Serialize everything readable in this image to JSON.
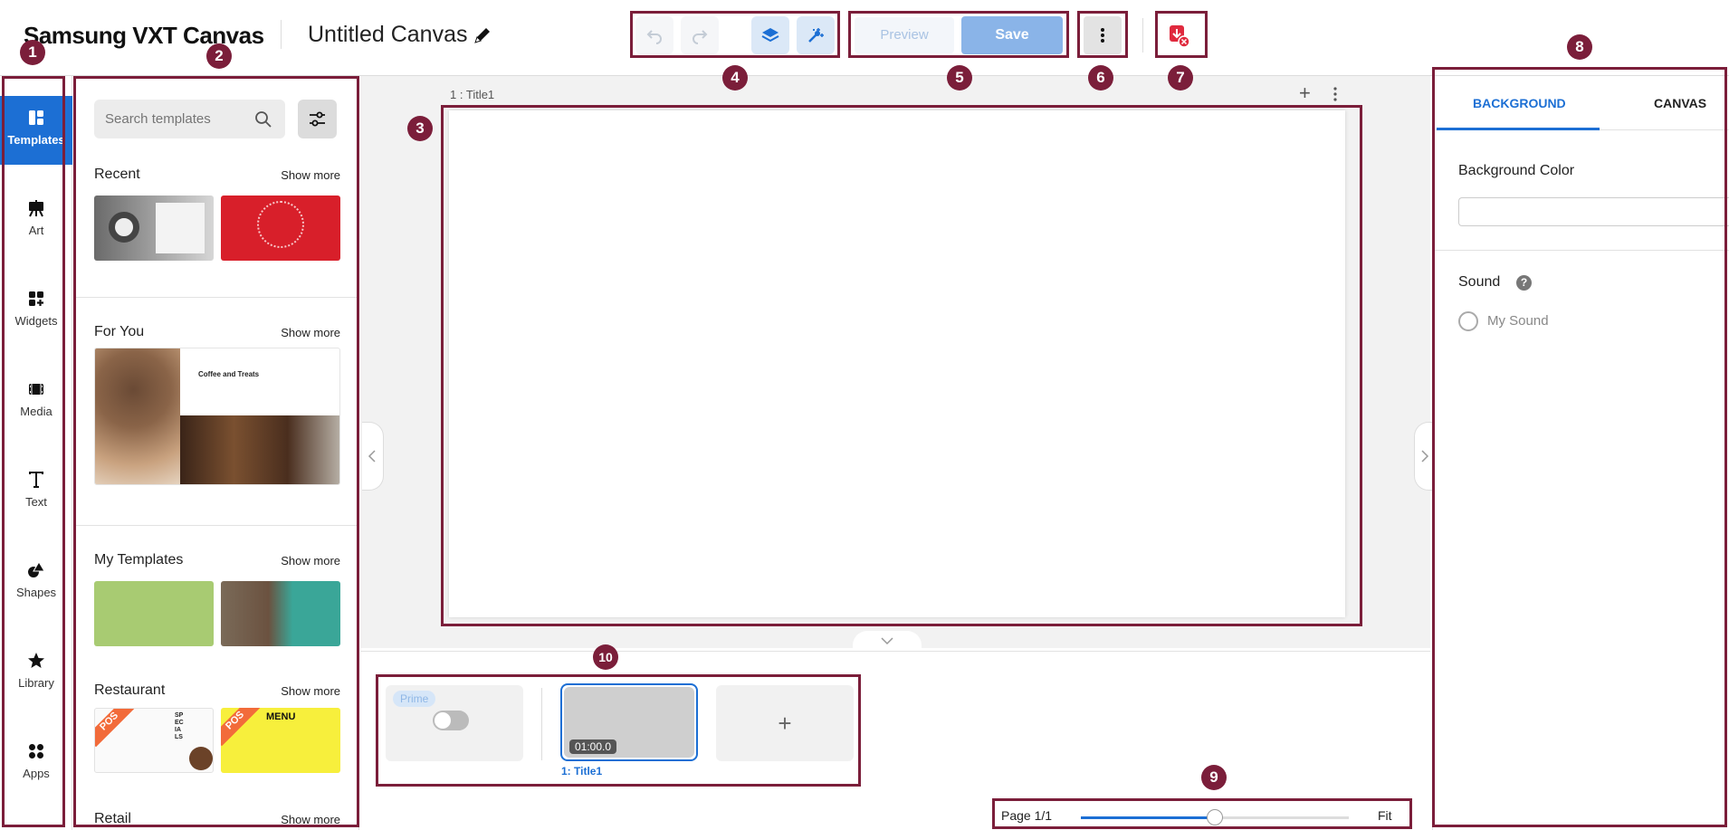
{
  "header": {
    "brand": "Samsung VXT Canvas",
    "canvas_title": "Untitled Canvas",
    "preview_label": "Preview",
    "save_label": "Save"
  },
  "annotations": [
    "1",
    "2",
    "3",
    "4",
    "5",
    "6",
    "7",
    "8",
    "9",
    "10"
  ],
  "rail": {
    "items": [
      {
        "label": "Templates",
        "icon": "templates-icon",
        "active": true
      },
      {
        "label": "Art",
        "icon": "art-easel-icon"
      },
      {
        "label": "Widgets",
        "icon": "widgets-icon"
      },
      {
        "label": "Media",
        "icon": "media-film-icon"
      },
      {
        "label": "Text",
        "icon": "text-icon"
      },
      {
        "label": "Shapes",
        "icon": "shapes-icon"
      },
      {
        "label": "Library",
        "icon": "star-icon"
      },
      {
        "label": "Apps",
        "icon": "apps-icon"
      }
    ]
  },
  "templates": {
    "search_placeholder": "Search templates",
    "sections": [
      {
        "title": "Recent",
        "show_more": "Show more"
      },
      {
        "title": "For You",
        "show_more": "Show more"
      },
      {
        "title": "My Templates",
        "show_more": "Show more"
      },
      {
        "title": "Restaurant",
        "show_more": "Show more"
      },
      {
        "title": "Retail",
        "show_more": "Show more"
      }
    ],
    "thumb_text": {
      "coffee_title": "Coffee and Treats",
      "pos": "POS",
      "menu": "MENU",
      "specials": "SPECIALS"
    }
  },
  "canvas": {
    "page_number": "1 :",
    "page_title": "Title1",
    "add_label": "+"
  },
  "timeline": {
    "prime_label": "Prime",
    "duration": "01:00.0",
    "page_label": "1:  Title1",
    "add_label": "+"
  },
  "zoom": {
    "page_label": "Page 1/1",
    "fit_label": "Fit",
    "level_fraction": 0.5
  },
  "properties": {
    "tabs": [
      {
        "label": "BACKGROUND",
        "active": true
      },
      {
        "label": "CANVAS"
      }
    ],
    "background_color_label": "Background Color",
    "sound_label": "Sound",
    "sound_help": "?",
    "sound_option": "My Sound"
  },
  "colors": {
    "accent": "#1c6fd4",
    "annotation": "#7b1e3a",
    "save_button": "#8ab4e8"
  }
}
